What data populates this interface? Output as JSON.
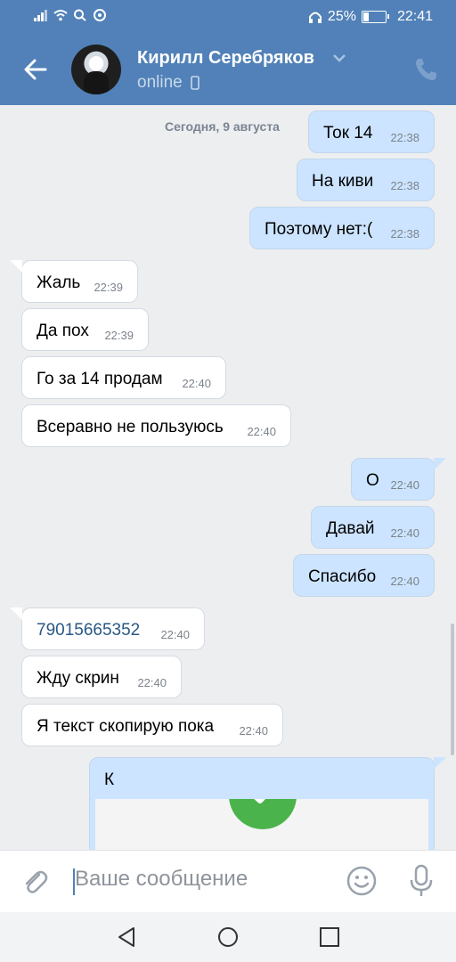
{
  "status_bar": {
    "battery": "25%",
    "time": "22:41"
  },
  "header": {
    "contact_name": "Кирилл Серебряков",
    "status": "online"
  },
  "chat": {
    "date": "Сегодня, 9 августа",
    "messages": [
      {
        "dir": "out",
        "text": "Ток 14",
        "time": "22:38"
      },
      {
        "dir": "out",
        "text": "На киви",
        "time": "22:38"
      },
      {
        "dir": "out",
        "text": "Поэтому нет:(",
        "time": "22:38"
      },
      {
        "dir": "in",
        "text": "Жаль",
        "time": "22:39"
      },
      {
        "dir": "in",
        "text": "Да пох",
        "time": "22:39"
      },
      {
        "dir": "in",
        "text": "Го за 14 продам",
        "time": "22:40"
      },
      {
        "dir": "in",
        "text": "Всеравно не пользуюсь",
        "time": "22:40"
      },
      {
        "dir": "out",
        "text": "О",
        "time": "22:40"
      },
      {
        "dir": "out",
        "text": "Давай",
        "time": "22:40"
      },
      {
        "dir": "out",
        "text": "Спасибо",
        "time": "22:40"
      },
      {
        "dir": "in",
        "text": "79015665352",
        "time": "22:40"
      },
      {
        "dir": "in",
        "text": "Жду скрин",
        "time": "22:40"
      },
      {
        "dir": "in",
        "text": "Я текст скопирую пока",
        "time": "22:40"
      }
    ],
    "last_card_text": "К"
  },
  "input": {
    "placeholder": "Ваше сообщение"
  },
  "colors": {
    "header_bg": "#5181b8",
    "outgoing_bubble": "#cce4ff",
    "incoming_bubble": "#ffffff",
    "chat_bg": "#edeef0",
    "link": "#2a5885",
    "success_green": "#4bb34b"
  },
  "icons": [
    "signal-icon",
    "wifi-icon",
    "search-icon",
    "chat-status-icon",
    "headphones-icon",
    "battery-icon",
    "back-arrow-icon",
    "chevron-down-icon",
    "mobile-phone-icon",
    "call-icon",
    "paperclip-icon",
    "emoji-icon",
    "microphone-icon",
    "nav-back-icon",
    "nav-home-icon",
    "nav-recent-icon",
    "checkmark-icon"
  ]
}
